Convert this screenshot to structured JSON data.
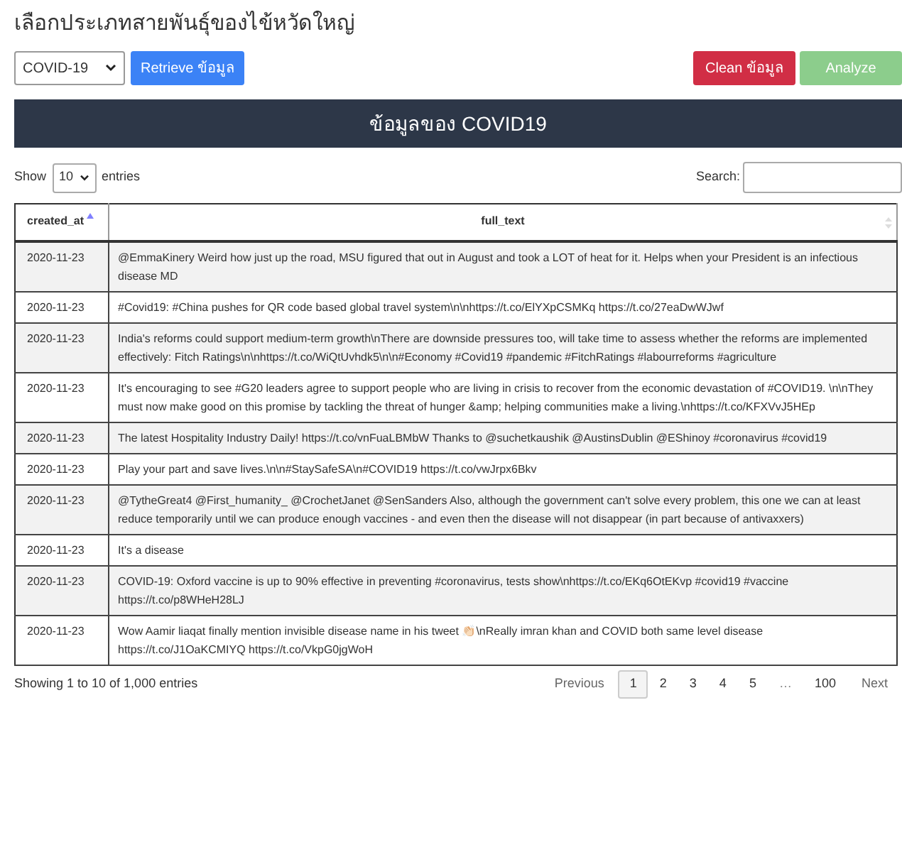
{
  "title": "เลือกประเภทสายพันธุ์ของไข้หวัดใหญ่",
  "strain_select": {
    "value": "COVID-19"
  },
  "buttons": [
    {
      "label": "Retrieve ข้อมูล",
      "kind": "primary"
    },
    {
      "label": "Clean ข้อมูล",
      "kind": "danger"
    },
    {
      "label": "Analyze",
      "kind": "success",
      "disabled": true
    }
  ],
  "banner": "ข้อมูลของ COVID19",
  "length_control": {
    "prefix": "Show",
    "value": "10",
    "suffix": "entries"
  },
  "search": {
    "label": "Search:"
  },
  "table": {
    "columns": [
      {
        "label": "created_at",
        "sorted_ascending": true
      },
      {
        "label": "full_text",
        "sorted_ascending": false
      }
    ],
    "rows": [
      [
        "2020-11-23",
        "@EmmaKinery Weird how just up the road, MSU figured that out in August and took a LOT of heat for it. Helps when your President is an infectious disease MD"
      ],
      [
        "2020-11-23",
        "#Covid19: #China pushes for QR code based global travel system\\n\\nhttps://t.co/ElYXpCSMKq https://t.co/27eaDwWJwf"
      ],
      [
        "2020-11-23",
        "India's reforms could support medium-term growth\\nThere are downside pressures too, will take time to assess whether the reforms are implemented effectively: Fitch Ratings\\n\\nhttps://t.co/WiQtUvhdk5\\n\\n#Economy #Covid19 #pandemic #FitchRatings #labourreforms #agriculture"
      ],
      [
        "2020-11-23",
        "It's encouraging to see #G20 leaders agree to support people who are living in crisis to recover from the economic devastation of #COVID19. \\n\\nThey must now make good on this promise by tackling the threat of hunger &amp; helping communities make a living.\\nhttps://t.co/KFXVvJ5HEp"
      ],
      [
        "2020-11-23",
        "The latest Hospitality Industry Daily! https://t.co/vnFuaLBMbW Thanks to @suchetkaushik @AustinsDublin @EShinoy #coronavirus #covid19"
      ],
      [
        "2020-11-23",
        "Play your part and save lives.\\n\\n#StaySafeSA\\n#COVID19 https://t.co/vwJrpx6Bkv"
      ],
      [
        "2020-11-23",
        "@TytheGreat4 @First_humanity_ @CrochetJanet @SenSanders Also, although the government can't solve every problem, this one we can at least reduce temporarily until we can produce enough vaccines - and even then the disease will not disappear (in part because of antivaxxers)"
      ],
      [
        "2020-11-23",
        "It's a disease"
      ],
      [
        "2020-11-23",
        "COVID-19: Oxford vaccine is up to 90% effective in preventing #coronavirus, tests show\\nhttps://t.co/EKq6OtEKvp #covid19 #vaccine https://t.co/p8WHeH28LJ"
      ],
      [
        "2020-11-23",
        "Wow Aamir liaqat finally mention invisible disease name in his tweet 👏🏻\\nReally imran khan and COVID both same level disease https://t.co/J1OaKCMIYQ https://t.co/VkpG0jgWoH"
      ]
    ]
  },
  "info": "Showing 1 to 10 of 1,000 entries",
  "pagination": [
    {
      "label": "Previous",
      "kind": "nav",
      "selected": false
    },
    {
      "label": "1",
      "kind": "page",
      "selected": true
    },
    {
      "label": "2",
      "kind": "page",
      "selected": false
    },
    {
      "label": "3",
      "kind": "page",
      "selected": false
    },
    {
      "label": "4",
      "kind": "page",
      "selected": false
    },
    {
      "label": "5",
      "kind": "page",
      "selected": false
    },
    {
      "label": "…",
      "kind": "ellipsis",
      "selected": false
    },
    {
      "label": "100",
      "kind": "page",
      "selected": false
    },
    {
      "label": "Next",
      "kind": "nav",
      "selected": false
    }
  ]
}
